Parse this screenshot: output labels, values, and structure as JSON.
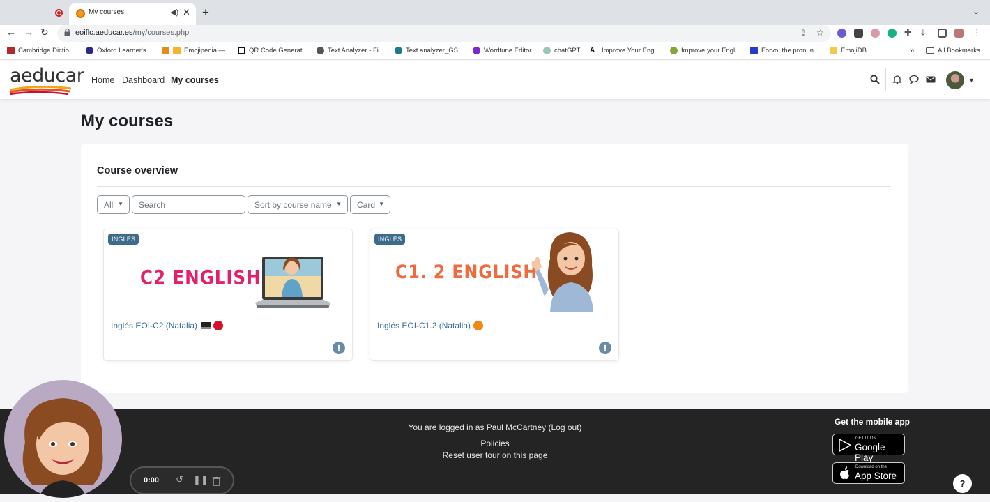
{
  "browser": {
    "tab_title": "My courses",
    "url_host": "eoiflc.aeducar.es",
    "url_path": "/my/courses.php",
    "bookmarks": [
      "Cambridge Dictio...",
      "Oxford Learner's...",
      "Emojipedia —...",
      "QR Code Generat...",
      "Text Analyzer - Fi...",
      "Text analyzer_GS...",
      "Wordtune Editor",
      "chatGPT",
      "Improve Your Engl...",
      "Improve your Engl...",
      "Forvo: the pronun...",
      "EmojiDB"
    ],
    "bookmarks_overflow": "»",
    "all_bookmarks": "All Bookmarks"
  },
  "header": {
    "logo": "aeducar",
    "nav": [
      "Home",
      "Dashboard",
      "My courses"
    ]
  },
  "page": {
    "title": "My courses",
    "section_title": "Course overview",
    "filter_all": "All",
    "search_placeholder": "Search",
    "sort": "Sort by course name",
    "view": "Card"
  },
  "courses": [
    {
      "badge": "INGLÉS",
      "image_text": "C2 ENGLISH",
      "name": "Inglés EOI-C2 (Natalia)",
      "dot_color": "#d8102a"
    },
    {
      "badge": "INGLÉS",
      "image_text": "C1. 2 ENGLISH",
      "name": "Inglés EOI-C1.2 (Natalia)",
      "dot_color": "#f08a0e"
    }
  ],
  "footer": {
    "logged_in": "You are logged in as Paul McCartney (Log out)",
    "policies": "Policies",
    "reset_tour": "Reset user tour on this page",
    "get_app": "Get the mobile app",
    "google_small": "GET IT ON",
    "google_big": "Google Play",
    "apple_small": "Download on the",
    "apple_big": "App Store",
    "help": "?"
  },
  "recorder": {
    "time": "0:00"
  },
  "colors": {
    "accent_link": "#3a6f96",
    "badge": "#3f6b8a",
    "footer_bg": "#242424",
    "c2_text": "#e3206b",
    "c12_text": "#ef6a3c"
  }
}
